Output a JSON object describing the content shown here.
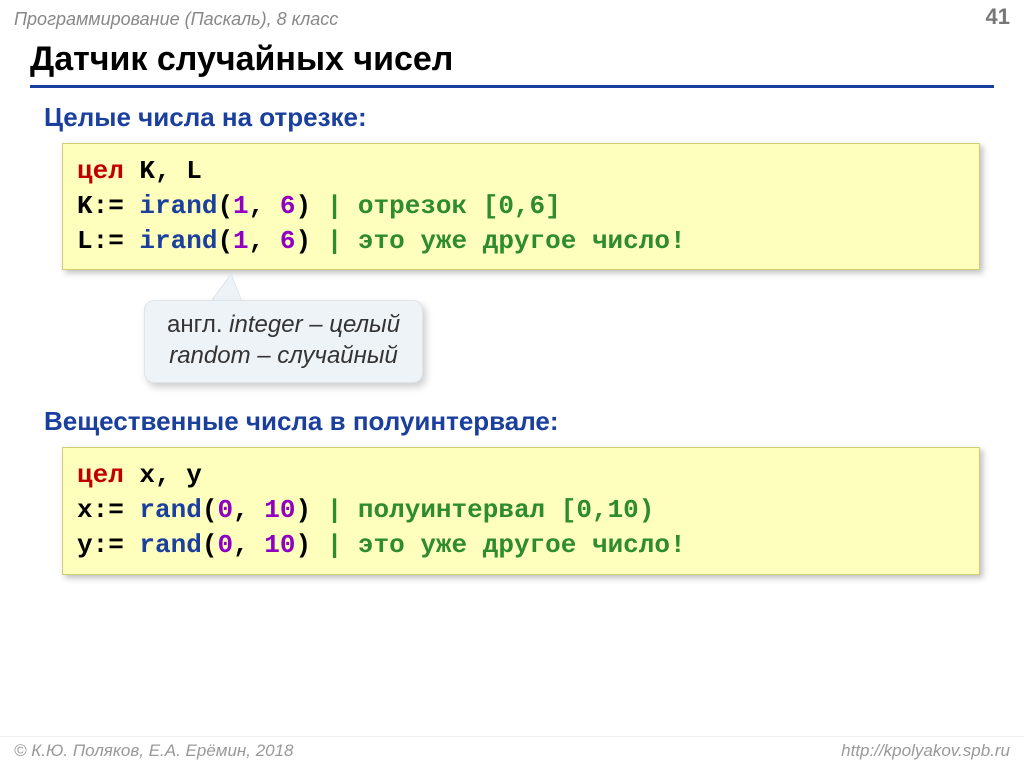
{
  "header": {
    "course": "Программирование (Паскаль), 8 класс",
    "page": "41"
  },
  "title": "Датчик случайных чисел",
  "sec1": {
    "heading": "Целые числа на отрезке:",
    "code": {
      "kw": "цел",
      "decl": " K, L",
      "l2a": "K:= ",
      "fn1": "irand",
      "l2b": "(",
      "n1": "1",
      "l2c": ", ",
      "n2": "6",
      "l2d": ") ",
      "c1": "| отрезок [0,6]",
      "l3a": "L:= ",
      "fn2": "irand",
      "l3b": "(",
      "n3": "1",
      "l3c": ", ",
      "n4": "6",
      "l3d": ") ",
      "c2": "| это уже другое число!"
    }
  },
  "note": {
    "l1a": "англ. ",
    "l1b": "integer",
    "l1c": " – целый",
    "l2a": "random",
    "l2b": " – случайный"
  },
  "sec2": {
    "heading": "Вещественные числа в полуинтервале:",
    "code": {
      "kw": "цел",
      "decl": " x, y",
      "l2a": "x:= ",
      "fn1": "rand",
      "l2b": "(",
      "n1": "0",
      "l2c": ", ",
      "n2": "10",
      "l2d": ") ",
      "c1": "| полуинтервал [0,10)",
      "l3a": "y:= ",
      "fn2": "rand",
      "l3b": "(",
      "n3": "0",
      "l3c": ", ",
      "n4": "10",
      "l3d": ") ",
      "c2": "| это уже другое число!"
    }
  },
  "footer": {
    "copyright": "© К.Ю. Поляков, Е.А. Ерёмин, 2018",
    "url": "http://kpolyakov.spb.ru"
  }
}
